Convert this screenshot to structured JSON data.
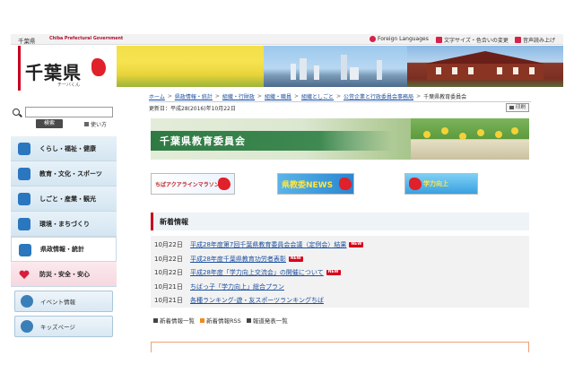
{
  "topbar": {
    "pref_name": "千葉県",
    "pref_name_en": "Chiba Prefectural Government",
    "links": [
      {
        "label": "Foreign Languages",
        "icon": "globe-icon",
        "color": "#d8204a"
      },
      {
        "label": "文字サイズ・色合いの変更",
        "icon": "font-size-icon",
        "color": "#d8204a"
      },
      {
        "label": "音声読み上げ",
        "icon": "speaker-icon",
        "color": "#d8204a"
      }
    ]
  },
  "logo": {
    "title": "千葉県",
    "sub": "チーバくん",
    "accent": "#c8001e"
  },
  "search": {
    "placeholder": "",
    "button_label": "検索",
    "howto_label": "使い方"
  },
  "sidebar": {
    "items": [
      {
        "label": "くらし・福祉・健康",
        "icon": "home-icon",
        "style": "blue"
      },
      {
        "label": "教育・文化・スポーツ",
        "icon": "education-icon",
        "style": "blue"
      },
      {
        "label": "しごと・産業・観光",
        "icon": "briefcase-icon",
        "style": "blue"
      },
      {
        "label": "環境・まちづくり",
        "icon": "environment-icon",
        "style": "blue"
      },
      {
        "label": "県政情報・統計",
        "icon": "building-icon",
        "style": "white"
      },
      {
        "label": "防災・安全・安心",
        "icon": "heart-icon",
        "style": "pink"
      }
    ],
    "small_items": [
      {
        "label": "イベント情報",
        "icon": "event-icon"
      },
      {
        "label": "キッズページ",
        "icon": "kids-icon"
      }
    ]
  },
  "breadcrumb": {
    "items": [
      "ホーム",
      "県政情報・統計",
      "組織・行財政",
      "組織・職員",
      "組織としごと",
      "公営企業と行政委員会事務局"
    ],
    "current": "千葉県教育委員会"
  },
  "page": {
    "updated": "更新日：平成28(2016)年10月22日",
    "print_label": "印刷",
    "banner_title": "千葉県教育委員会"
  },
  "link_banners": [
    {
      "label": "ちばアクアラインマラソン"
    },
    {
      "label": "県教委NEWS"
    },
    {
      "label": "学力向上"
    }
  ],
  "news": {
    "heading": "新着情報",
    "new_label": "NEW",
    "items": [
      {
        "date": "10月22日",
        "title": "平成28年度第7回千葉県教育委員会会議（定例会）結果",
        "is_new": true
      },
      {
        "date": "10月22日",
        "title": "平成28年度千葉県教育功労者表彰",
        "is_new": true
      },
      {
        "date": "10月22日",
        "title": "平成28年度「学力向上交流会」の開催について",
        "is_new": true
      },
      {
        "date": "10月21日",
        "title": "ちばっ子「学力向上」総合プラン",
        "is_new": false
      },
      {
        "date": "10月21日",
        "title": "各種ランキング-遊・友スポーツランキングちば",
        "is_new": false
      }
    ],
    "footer": [
      {
        "label": "新着情報一覧",
        "icon": "list-icon"
      },
      {
        "label": "新着情報RSS",
        "icon": "rss-icon"
      },
      {
        "label": "報道発表一覧",
        "icon": "list-icon"
      }
    ]
  }
}
